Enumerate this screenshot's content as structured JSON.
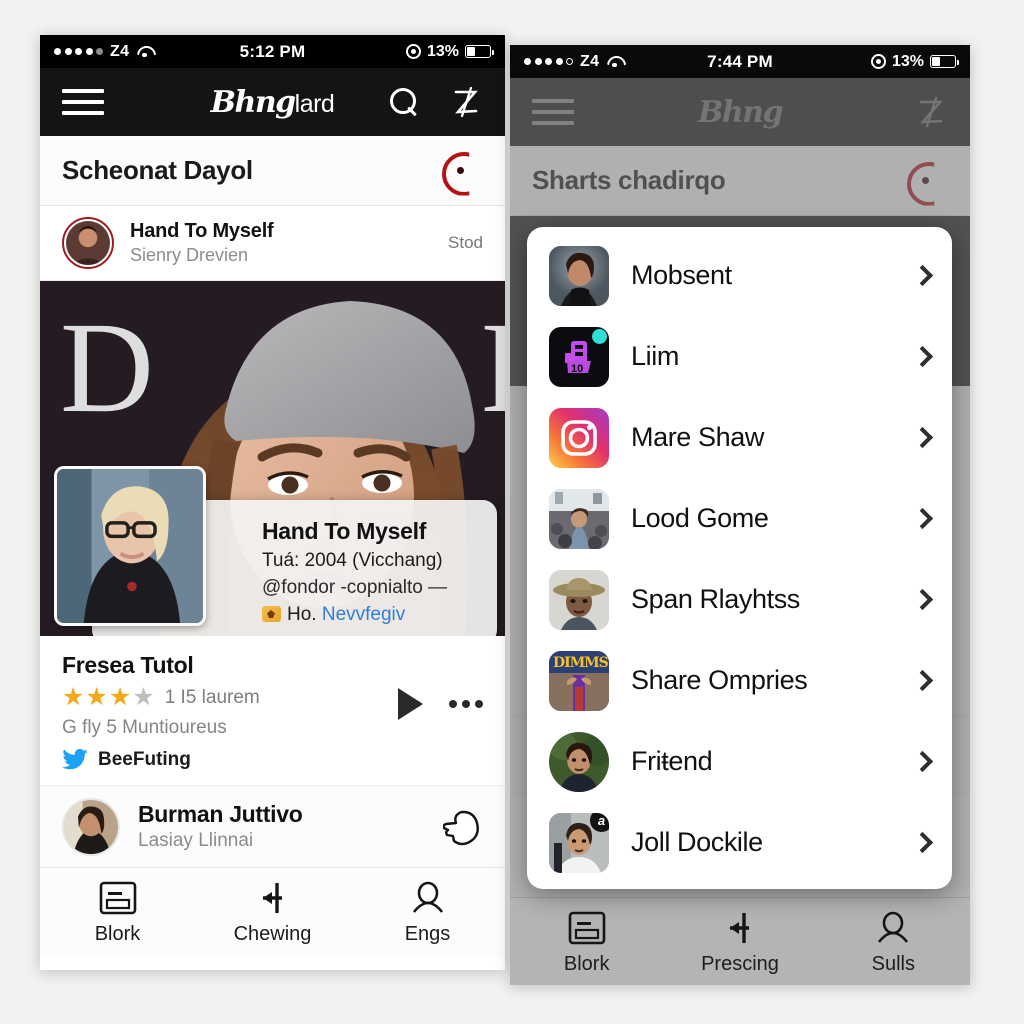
{
  "left_phone": {
    "status_bar": {
      "signal_dots": 4,
      "signal_total": 5,
      "carrier": "Z4",
      "wifi_icon": "wifi-icon",
      "time": "5:12 PM",
      "alarm_icon": "alarm-icon",
      "battery_pct": "13%",
      "battery_level": 38
    },
    "nav": {
      "menu_icon": "hamburger-menu-icon",
      "brand_gothic": "Bhng",
      "brand_plain": "lard",
      "search_icon": "search-icon",
      "profile_icon": "z-signature-icon"
    },
    "section": {
      "title": "Scheonat Dayol",
      "refresh_icon": "refresh-icon"
    },
    "feed_row": {
      "avatar": "avatar-woman-dark",
      "title": "Hand To Myself",
      "subtitle": "Sienry Drevien",
      "status": "Stod"
    },
    "hero": {
      "backdrop_letters": "D I",
      "photo": "portrait-woman-grey-beanie",
      "thumbnail": "portrait-blonde-glasses",
      "card": {
        "title": "Hand To Myself",
        "line1": "Tuá: 2004 (Vicchang)",
        "line2": "@fondor -copnialto —",
        "flag_icon": "flag-badge-icon",
        "line3_prefix": "Ho.",
        "line3_link": "Nevvfegiv"
      }
    },
    "meta": {
      "title": "Fresea Tutol",
      "stars_filled": 3,
      "stars_total": 5,
      "stars_label": "1 I5 laurem",
      "subtitle": "G fly 5 Muntioureus",
      "twitter_icon": "twitter-bird-icon",
      "twitter_label": "BeeFuting",
      "play_icon": "play-icon",
      "more_icon": "more-dots-icon"
    },
    "person_row": {
      "avatar": "avatar-woman-portrait",
      "name": "Burman Juttivo",
      "subtitle": "Lasiay Llinnai",
      "action_icon": "thumbs-up-icon"
    },
    "tabbar": [
      {
        "icon": "article-card-icon",
        "label": "Blork"
      },
      {
        "icon": "arrow-cross-icon",
        "label": "Chewing"
      },
      {
        "icon": "person-icon",
        "label": "Engs"
      }
    ]
  },
  "right_phone": {
    "status_bar": {
      "signal_dots": 4,
      "signal_total": 5,
      "carrier": "Z4",
      "wifi_icon": "wifi-icon",
      "time": "7:44 PM",
      "alarm_icon": "alarm-icon",
      "battery_pct": "13%",
      "battery_level": 38
    },
    "nav": {
      "menu_icon": "hamburger-menu-icon",
      "brand_gothic": "Bhng",
      "brand_plain": "",
      "profile_icon": "z-signature-icon"
    },
    "section": {
      "title": "Sharts chadirqo",
      "refresh_icon": "refresh-icon"
    },
    "share_sheet": {
      "items": [
        {
          "icon": "avatar-woman-tanktop",
          "label": "Mobsent",
          "shape": "square",
          "badge": ""
        },
        {
          "icon": "app-icon-purple-camera",
          "label": "Liim",
          "shape": "square",
          "badge": "dot"
        },
        {
          "icon": "instagram-icon",
          "label": "Mare Shaw",
          "shape": "square",
          "badge": ""
        },
        {
          "icon": "photo-crowd-festival",
          "label": "Lood Gome",
          "shape": "square",
          "badge": ""
        },
        {
          "icon": "photo-man-hat",
          "label": "Span Rlayhtss",
          "shape": "square",
          "badge": ""
        },
        {
          "icon": "app-icon-yellow-poster",
          "label": "Share Ompries",
          "shape": "square",
          "badge": ""
        },
        {
          "icon": "avatar-man-outdoors",
          "label": "Friŧend",
          "shape": "round",
          "badge": ""
        },
        {
          "icon": "photo-man-whiteshirt",
          "label": "Joll Dockile",
          "shape": "square",
          "badge": "a"
        }
      ]
    },
    "tabbar": [
      {
        "icon": "article-card-icon",
        "label": "Blork"
      },
      {
        "icon": "arrow-cross-icon",
        "label": "Prescing"
      },
      {
        "icon": "person-icon",
        "label": "Sulls"
      }
    ]
  },
  "colors": {
    "page_bg": "#f2f2f0",
    "nav_bg": "#141414",
    "accent_red": "#b31217",
    "link_blue": "#2f7fd6",
    "star_gold": "#f2a818",
    "twitter_blue": "#1da1f2",
    "scrim": "#808080"
  }
}
